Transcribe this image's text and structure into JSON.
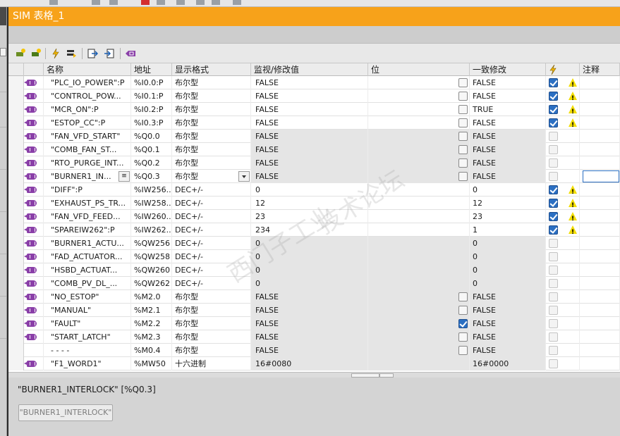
{
  "window": {
    "title": "SIM 表格_1"
  },
  "toolbar": {
    "icons": [
      "add-row-icon",
      "insert-row-icon",
      "modify-now-icon",
      "write-icon",
      "export-icon",
      "import-icon",
      "tag-icon"
    ]
  },
  "columns": {
    "name": "名称",
    "address": "地址",
    "display_format": "显示格式",
    "monitor_value": "监视/修改值",
    "bit": "位",
    "consistent_modify": "一致修改",
    "flash_icon": "flash-icon",
    "comment": "注释"
  },
  "rows": [
    {
      "name": "\"PLC_IO_POWER\":P",
      "address": "%I0.0:P",
      "format": "布尔型",
      "monitor": "FALSE",
      "bit": "unchecked",
      "modify": "FALSE",
      "flag": "checked",
      "warn": true
    },
    {
      "name": "\"CONTROL_POW...",
      "address": "%I0.1:P",
      "format": "布尔型",
      "monitor": "FALSE",
      "bit": "unchecked",
      "modify": "FALSE",
      "flag": "checked",
      "warn": true
    },
    {
      "name": "\"MCR_ON\":P",
      "address": "%I0.2:P",
      "format": "布尔型",
      "monitor": "FALSE",
      "bit": "unchecked",
      "modify": "TRUE",
      "flag": "checked",
      "warn": true
    },
    {
      "name": "\"ESTOP_CC\":P",
      "address": "%I0.3:P",
      "format": "布尔型",
      "monitor": "FALSE",
      "bit": "unchecked",
      "modify": "FALSE",
      "flag": "checked",
      "warn": true
    },
    {
      "name": "\"FAN_VFD_START\"",
      "address": "%Q0.0",
      "format": "布尔型",
      "monitor": "FALSE",
      "bit": "unchecked",
      "modify": "FALSE",
      "flag": "dim",
      "warn": false,
      "shade": true
    },
    {
      "name": "\"COMB_FAN_ST...",
      "address": "%Q0.1",
      "format": "布尔型",
      "monitor": "FALSE",
      "bit": "unchecked",
      "modify": "FALSE",
      "flag": "dim",
      "warn": false,
      "shade": true
    },
    {
      "name": "\"RTO_PURGE_INT...",
      "address": "%Q0.2",
      "format": "布尔型",
      "monitor": "FALSE",
      "bit": "unchecked",
      "modify": "FALSE",
      "flag": "dim",
      "warn": false,
      "shade": true
    },
    {
      "name": "\"BURNER1_IN...",
      "address": "%Q0.3",
      "format": "布尔型",
      "monitor": "FALSE",
      "bit": "unchecked",
      "modify": "FALSE",
      "flag": "dim",
      "warn": false,
      "shade": true,
      "selected": true
    },
    {
      "name": "\"DIFF\":P",
      "address": "%IW256...",
      "format": "DEC+/-",
      "monitor": "0",
      "bit": "none",
      "modify": "0",
      "flag": "checked",
      "warn": true
    },
    {
      "name": "\"EXHAUST_PS_TR...",
      "address": "%IW258...",
      "format": "DEC+/-",
      "monitor": "12",
      "bit": "none",
      "modify": "12",
      "flag": "checked",
      "warn": true
    },
    {
      "name": "\"FAN_VFD_FEED...",
      "address": "%IW260...",
      "format": "DEC+/-",
      "monitor": "23",
      "bit": "none",
      "modify": "23",
      "flag": "checked",
      "warn": true
    },
    {
      "name": "\"SPAREIW262\":P",
      "address": "%IW262...",
      "format": "DEC+/-",
      "monitor": "234",
      "bit": "none",
      "modify": "1",
      "flag": "checked",
      "warn": true
    },
    {
      "name": "\"BURNER1_ACTU...",
      "address": "%QW256",
      "format": "DEC+/-",
      "monitor": "0",
      "bit": "none",
      "modify": "0",
      "flag": "dim",
      "warn": false,
      "shade": true
    },
    {
      "name": "\"FAD_ACTUATOR...",
      "address": "%QW258",
      "format": "DEC+/-",
      "monitor": "0",
      "bit": "none",
      "modify": "0",
      "flag": "dim",
      "warn": false,
      "shade": true
    },
    {
      "name": "\"HSBD_ACTUAT...",
      "address": "%QW260",
      "format": "DEC+/-",
      "monitor": "0",
      "bit": "none",
      "modify": "0",
      "flag": "dim",
      "warn": false,
      "shade": true
    },
    {
      "name": "\"COMB_PV_DL_...",
      "address": "%QW262",
      "format": "DEC+/-",
      "monitor": "0",
      "bit": "none",
      "modify": "0",
      "flag": "dim",
      "warn": false,
      "shade": true
    },
    {
      "name": "\"NO_ESTOP\"",
      "address": "%M2.0",
      "format": "布尔型",
      "monitor": "FALSE",
      "bit": "unchecked",
      "modify": "FALSE",
      "flag": "dim",
      "warn": false,
      "shade": true
    },
    {
      "name": "\"MANUAL\"",
      "address": "%M2.1",
      "format": "布尔型",
      "monitor": "FALSE",
      "bit": "unchecked",
      "modify": "FALSE",
      "flag": "dim",
      "warn": false,
      "shade": true
    },
    {
      "name": "\"FAULT\"",
      "address": "%M2.2",
      "format": "布尔型",
      "monitor": "FALSE",
      "bit": "checked",
      "modify": "FALSE",
      "flag": "dim",
      "warn": false,
      "shade": true
    },
    {
      "name": "\"START_LATCH\"",
      "address": "%M2.3",
      "format": "布尔型",
      "monitor": "FALSE",
      "bit": "unchecked",
      "modify": "FALSE",
      "flag": "dim",
      "warn": false,
      "shade": true
    },
    {
      "name": "- - - -",
      "address": "%M0.4",
      "format": "布尔型",
      "monitor": "FALSE",
      "bit": "unchecked",
      "modify": "FALSE",
      "flag": "dim",
      "warn": false,
      "shade": true,
      "no_icon": true
    },
    {
      "name": "\"F1_WORD1\"",
      "address": "%MW50",
      "format": "十六进制",
      "monitor": "16#0080",
      "bit": "none",
      "modify": "16#0000",
      "flag": "dim",
      "warn": false,
      "shade": true
    }
  ],
  "detail": {
    "title": "\"BURNER1_INTERLOCK\" [%Q0.3]",
    "button_label": "\"BURNER1_INTERLOCK\""
  },
  "colors": {
    "accent": "#f7a21a",
    "tag_icon": "#8a3fa8",
    "check_blue": "#2b6fc2",
    "warn_yellow": "#f2dd00"
  }
}
